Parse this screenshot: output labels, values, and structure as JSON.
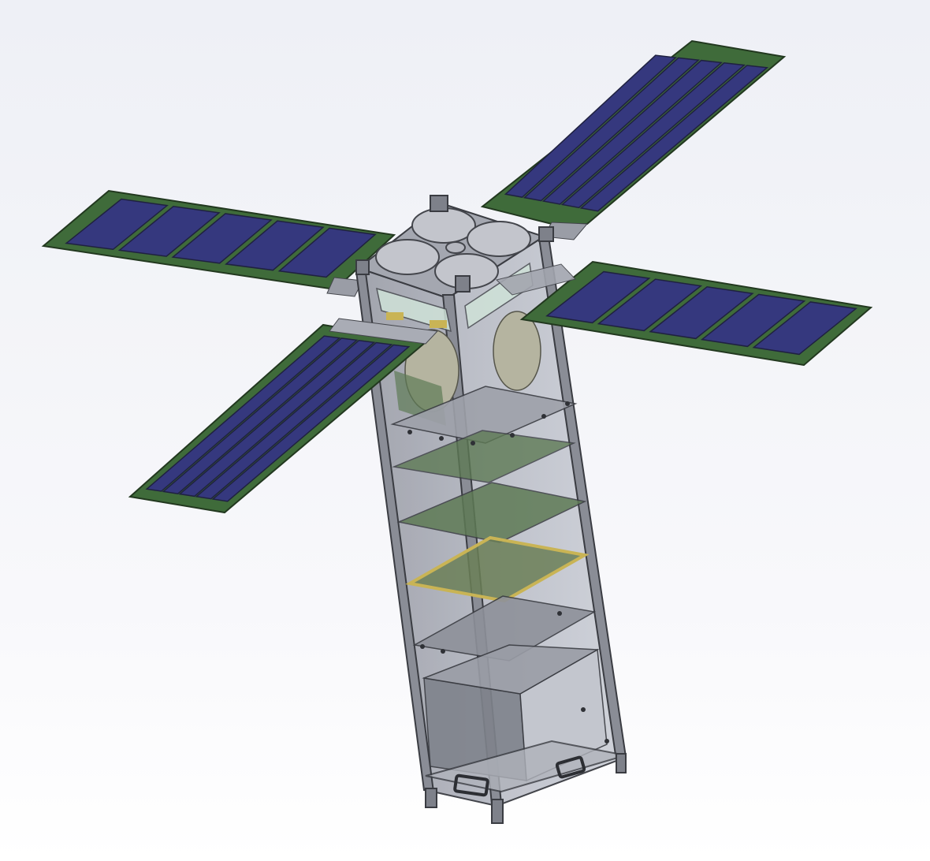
{
  "viewport": {
    "background_top": "#eef0f6",
    "background_bottom": "#ffffff"
  },
  "model": {
    "subject": "cubesat-3u-with-deployable-solar-arrays",
    "colors": {
      "solar_cell": "#35387e",
      "solar_cell_edge": "#1f2140",
      "panel_substrate": "#3f6b3a",
      "panel_substrate_edge": "#22381f",
      "frame": "#8a8d96",
      "frame_edge": "#3a3c42",
      "shell": "#a9acb5",
      "pcb": "#5e7a55",
      "gold_connector": "#c9b455",
      "reaction_wheel": "#b5b4a0"
    },
    "solar_arrays": [
      {
        "name": "panel-upper-left",
        "cells": 5
      },
      {
        "name": "panel-upper-right",
        "cells": 5
      },
      {
        "name": "panel-right",
        "cells": 5
      },
      {
        "name": "panel-lower-left",
        "cells": 5
      }
    ]
  }
}
